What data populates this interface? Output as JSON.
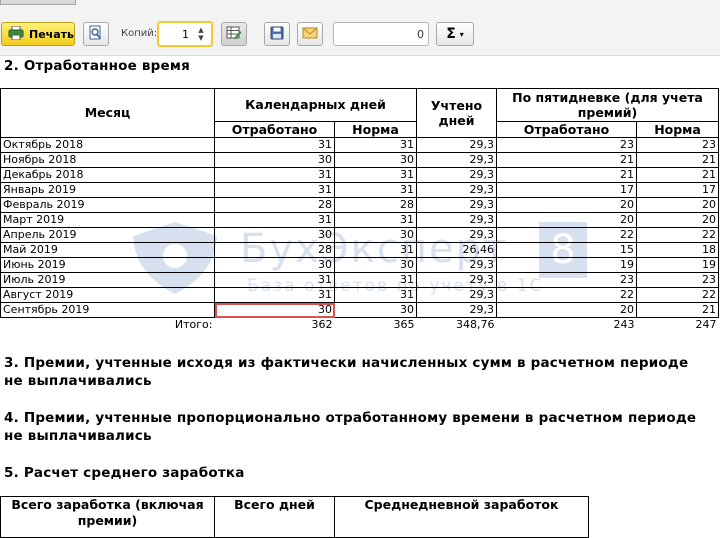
{
  "toolbar": {
    "print_label": "Печать",
    "copies_label": "Копий:",
    "copies_value": "1",
    "sum_value": "0",
    "sigma": "Σ",
    "caret": "▾"
  },
  "section2": {
    "title": "2. Отработанное время",
    "headers": {
      "month": "Месяц",
      "calendar": "Календарных дней",
      "counted": "Учтено дней",
      "fiveday": "По пятидневке (для учета премий)",
      "worked": "Отработано",
      "norm": "Норма",
      "worked2": "Отработано",
      "norm2": "Норма"
    },
    "rows": [
      {
        "month": "Октябрь 2018",
        "worked": "31",
        "norm": "31",
        "counted": "29,3",
        "worked5": "23",
        "norm5": "23"
      },
      {
        "month": "Ноябрь 2018",
        "worked": "30",
        "norm": "30",
        "counted": "29,3",
        "worked5": "21",
        "norm5": "21"
      },
      {
        "month": "Декабрь 2018",
        "worked": "31",
        "norm": "31",
        "counted": "29,3",
        "worked5": "21",
        "norm5": "21"
      },
      {
        "month": "Январь 2019",
        "worked": "31",
        "norm": "31",
        "counted": "29,3",
        "worked5": "17",
        "norm5": "17"
      },
      {
        "month": "Февраль 2019",
        "worked": "28",
        "norm": "28",
        "counted": "29,3",
        "worked5": "20",
        "norm5": "20"
      },
      {
        "month": "Март 2019",
        "worked": "31",
        "norm": "31",
        "counted": "29,3",
        "worked5": "20",
        "norm5": "20"
      },
      {
        "month": "Апрель 2019",
        "worked": "30",
        "norm": "30",
        "counted": "29,3",
        "worked5": "22",
        "norm5": "22"
      },
      {
        "month": "Май 2019",
        "worked": "28",
        "norm": "31",
        "counted": "26,46",
        "worked5": "15",
        "norm5": "18"
      },
      {
        "month": "Июнь 2019",
        "worked": "30",
        "norm": "30",
        "counted": "29,3",
        "worked5": "19",
        "norm5": "19"
      },
      {
        "month": "Июль 2019",
        "worked": "31",
        "norm": "31",
        "counted": "29,3",
        "worked5": "23",
        "norm5": "23"
      },
      {
        "month": "Август 2019",
        "worked": "31",
        "norm": "31",
        "counted": "29,3",
        "worked5": "22",
        "norm5": "22"
      },
      {
        "month": "Сентябрь 2019",
        "worked": "30",
        "norm": "30",
        "counted": "29,3",
        "worked5": "20",
        "norm5": "21"
      }
    ],
    "total": {
      "label": "Итого:",
      "worked": "362",
      "norm": "365",
      "counted": "348,76",
      "worked5": "243",
      "norm5": "247"
    }
  },
  "section3": {
    "title_line1": "3. Премии, учтенные исходя из фактически начисленных сумм в расчетном периоде",
    "title_line2": "не выплачивались"
  },
  "section4": {
    "title_line1": "4. Премии, учтенные пропорционально отработанному времени в расчетном периоде",
    "title_line2": "не выплачивались"
  },
  "section5": {
    "title": "5. Расчет среднего  заработка",
    "headers": {
      "total_earnings": "Всего заработка (включая премии)",
      "total_days": "Всего дней",
      "avg_daily": "Среднедневной заработок"
    }
  },
  "watermark": {
    "brand": "БухЭксперт",
    "eight": "8",
    "tagline": "База ответов по учету в 1С"
  },
  "colors": {
    "print_button": "#f2cc1e",
    "copies_focus": "#f4c928",
    "highlight": "#d9534f",
    "watermark": "#4a78b8"
  }
}
